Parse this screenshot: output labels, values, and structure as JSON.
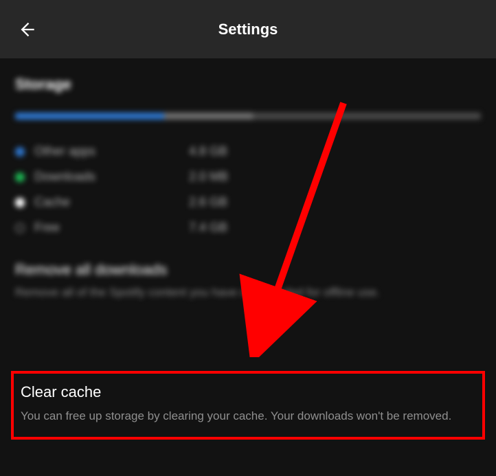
{
  "header": {
    "title": "Settings"
  },
  "storage": {
    "section_title": "Storage",
    "bar": [
      {
        "color": "blue",
        "percent": 32
      },
      {
        "color": "gray1",
        "percent": 19
      },
      {
        "color": "dark",
        "percent": 49
      }
    ],
    "legend": [
      {
        "dot": "blue",
        "label": "Other apps",
        "value": "4.8 GB"
      },
      {
        "dot": "green",
        "label": "Downloads",
        "value": "2.0 MB"
      },
      {
        "dot": "white",
        "label": "Cache",
        "value": "2.6 GB"
      },
      {
        "dot": "outline",
        "label": "Free",
        "value": "7.4 GB"
      }
    ]
  },
  "remove_downloads": {
    "title": "Remove all downloads",
    "description": "Remove all of the Spotify content you have downloaded for offline use."
  },
  "clear_cache": {
    "title": "Clear cache",
    "description": "You can free up storage by clearing your cache. Your downloads won't be removed."
  },
  "annotation": {
    "highlight_color": "#ff0000"
  }
}
